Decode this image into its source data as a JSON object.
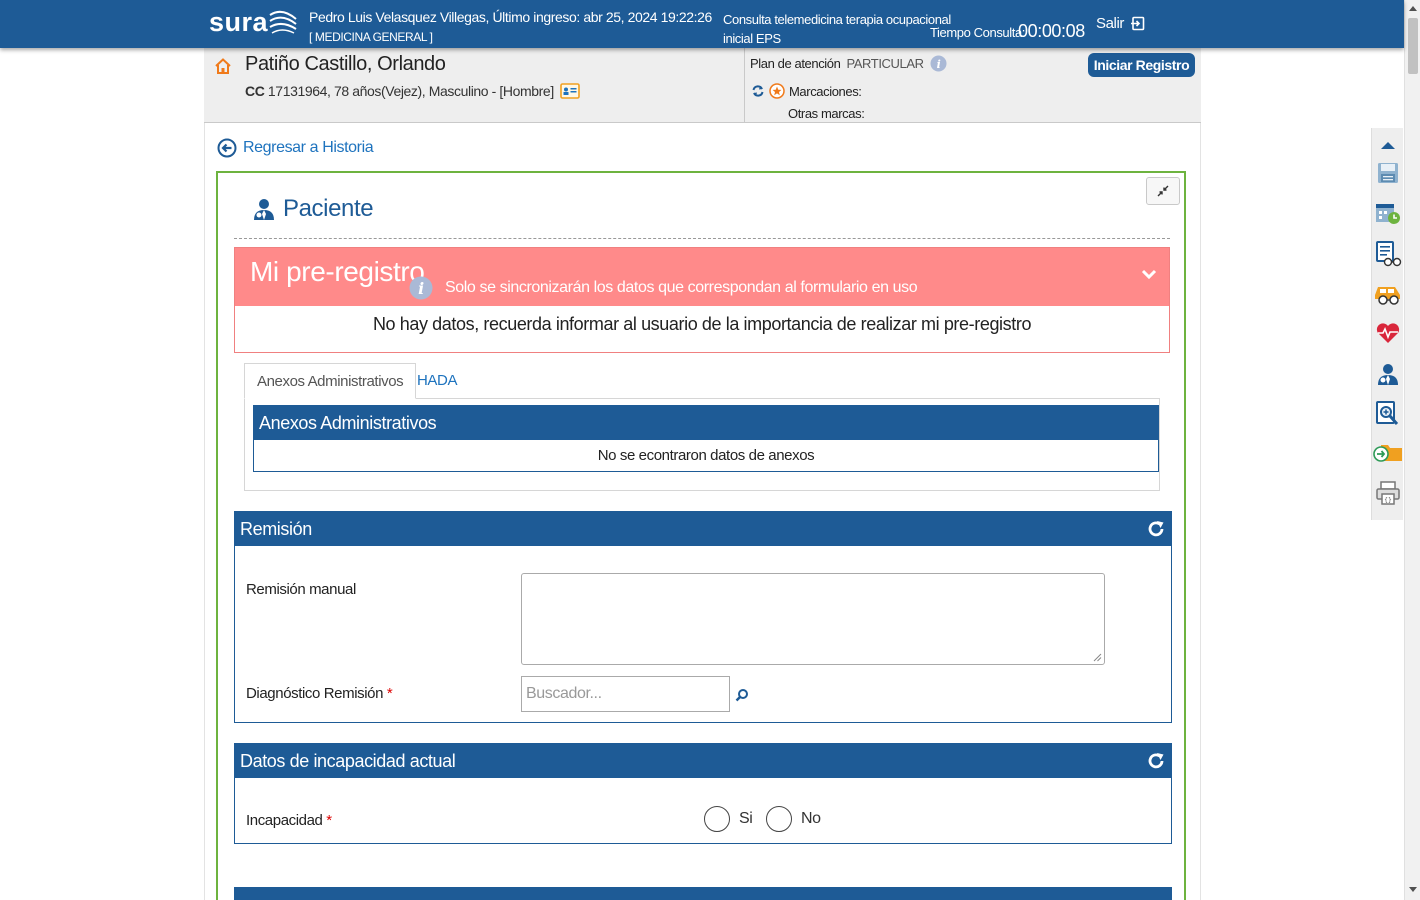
{
  "topbar": {
    "logo": "sura",
    "user_line": "Pedro Luis Velasquez Villegas, Último ingreso: abr 25, 2024 19:22:26",
    "specialty": "[ MEDICINA GENERAL ]",
    "consult_line1": "Consulta telemedicina terapia ocupacional",
    "consult_line2": "inicial EPS",
    "tiempo_label": "Tiempo Consulta:",
    "tiempo_value": "00:00:08",
    "salir_label": "Salir"
  },
  "patient": {
    "name": "Patiño Castillo, Orlando",
    "doc_type": "CC",
    "info": "17131964, 78 años(Vejez), Masculino - [Hombre]",
    "plan_label": "Plan de atención",
    "plan_value": "PARTICULAR",
    "marcaciones_label": "Marcaciones:",
    "otras_label": "Otras marcas:",
    "iniciar_label": "Iniciar Registro"
  },
  "nav": {
    "regresar_label": "Regresar a Historia"
  },
  "paciente_panel": {
    "title": "Paciente",
    "prereg_title": "Mi pre-registro",
    "prereg_note": "Solo se sincronizarán los datos que correspondan al formulario en uso",
    "prereg_empty": "No hay datos, recuerda informar al usuario de la importancia de realizar mi pre-registro",
    "tabs": [
      {
        "label": "Anexos Administrativos",
        "active": true
      },
      {
        "label": "HADA",
        "active": false
      }
    ],
    "anexos_header": "Anexos Administrativos",
    "anexos_empty": "No se econtraron datos de anexos"
  },
  "remision": {
    "title": "Remisión",
    "manual_label": "Remisión manual",
    "manual_value": "",
    "diag_label": "Diagnóstico Remisión",
    "diag_placeholder": "Buscador..."
  },
  "incapacidad": {
    "title": "Datos de incapacidad actual",
    "label": "Incapacidad",
    "options": [
      "Si",
      "No"
    ]
  },
  "colors": {
    "brand_blue": "#1e5b96",
    "green_border": "#6db33f",
    "prereg_pink": "#ff8a8a",
    "link_blue": "#1e73be"
  },
  "tools": [
    "scroll-top-icon",
    "save-icon",
    "agenda-icon",
    "report-glasses-icon",
    "vehicle-glasses-icon",
    "heart-monitor-icon",
    "doctor-icon",
    "search-document-icon",
    "folder-arrow-icon",
    "print-icon"
  ]
}
